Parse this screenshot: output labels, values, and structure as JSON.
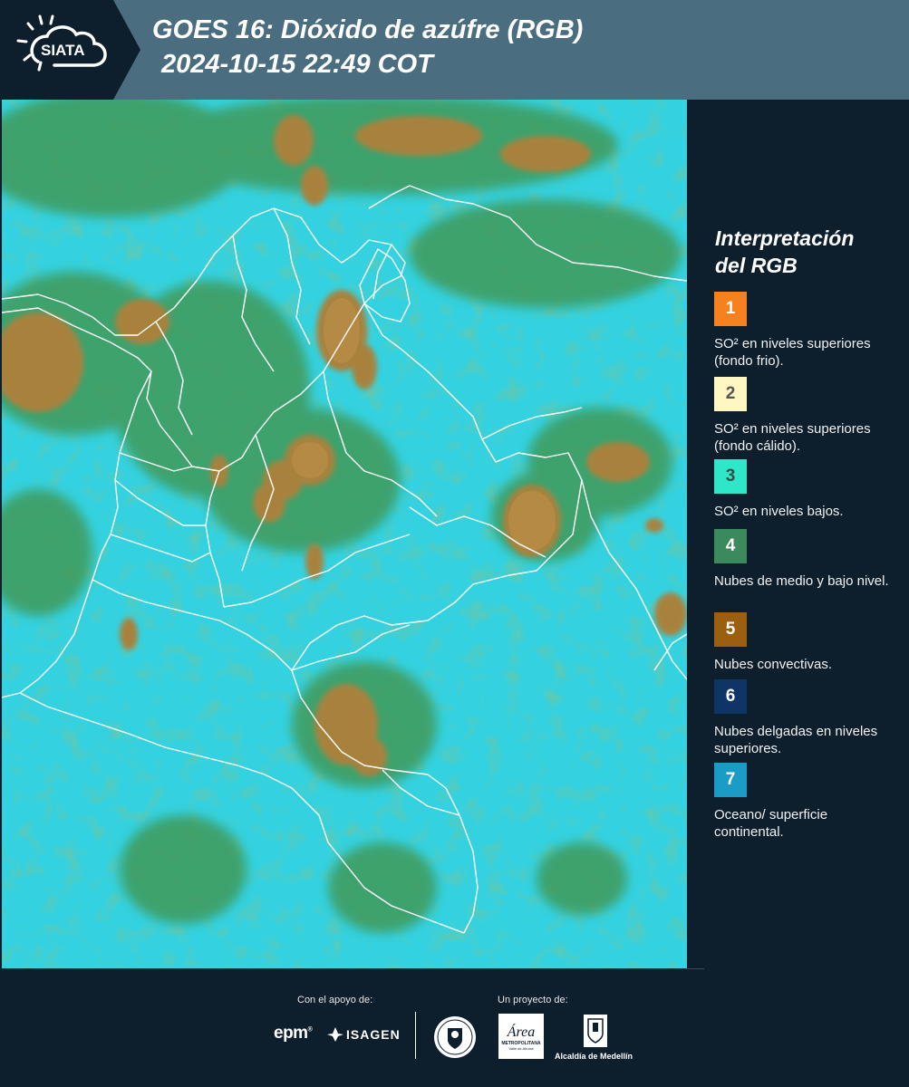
{
  "header": {
    "logo_text": "SIATA",
    "title_line1": "GOES 16: Dióxido de azúfre (RGB)",
    "title_line2": "2024-10-15 22:49 COT"
  },
  "legend": {
    "title_line1": "Interpretación",
    "title_line2": "del RGB",
    "items": [
      {
        "num": "1",
        "color": "#f5821f",
        "num_color": "#ffffff",
        "label": "SO² en niveles superiores (fondo frio)."
      },
      {
        "num": "2",
        "color": "#fff7c2",
        "num_color": "#555555",
        "label": "SO² en niveles superiores (fondo cálido)."
      },
      {
        "num": "3",
        "color": "#2ee6c8",
        "num_color": "#3a4a4a",
        "label": "SO² en niveles bajos."
      },
      {
        "num": "4",
        "color": "#3a8a5e",
        "num_color": "#ffffff",
        "label": "Nubes de medio y bajo nivel."
      },
      {
        "num": "5",
        "color": "#9b5f0f",
        "num_color": "#ffffff",
        "label": "Nubes convectivas."
      },
      {
        "num": "6",
        "color": "#0f3566",
        "num_color": "#ffffff",
        "label": "Nubes delgadas en niveles superiores."
      },
      {
        "num": "7",
        "color": "#1b9cc6",
        "num_color": "#ffffff",
        "label": "Oceano/ superficie continental."
      }
    ]
  },
  "footer": {
    "support_caption": "Con el apoyo de:",
    "project_caption": "Un proyecto de:",
    "logo_epm": "epm",
    "logo_isagen": "ISAGEN",
    "logo_area": "Área",
    "logo_area_sub": "METROPOLITANA",
    "logo_area_sub2": "Valle de Aburrá",
    "logo_alcaldia": "Alcaldía de Medellín"
  }
}
